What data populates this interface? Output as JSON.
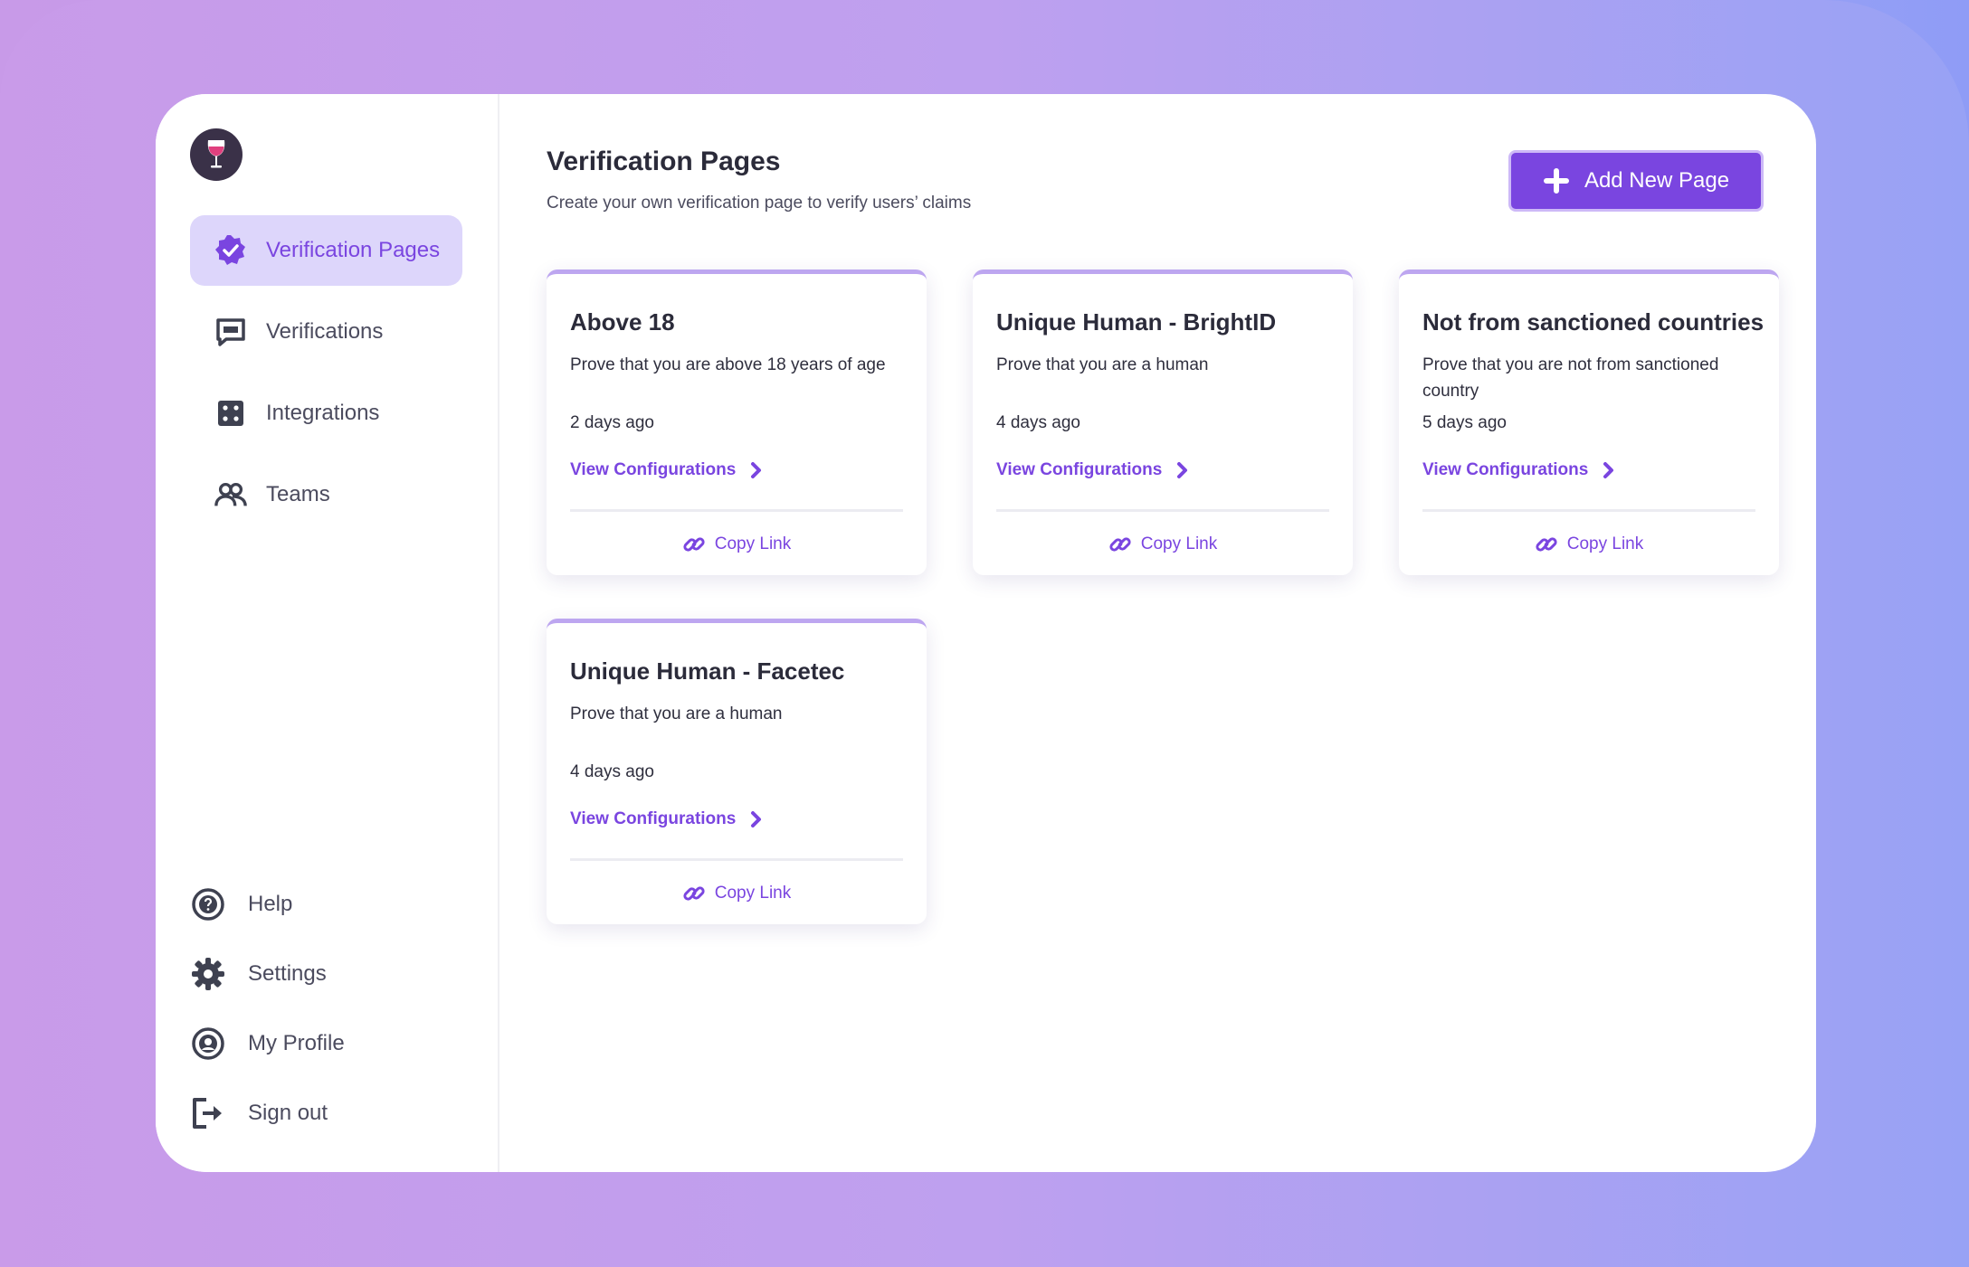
{
  "theme": {
    "accent": "#7a45e0",
    "accent_light": "#ddd6fb",
    "text_dark": "#2b2b3a",
    "text_muted": "#4b4b5e"
  },
  "sidebar": {
    "logo_icon": "wine-glass-icon",
    "nav": [
      {
        "label": "Verification Pages",
        "icon": "badge-check-icon",
        "active": true
      },
      {
        "label": "Verifications",
        "icon": "message-square-icon",
        "active": false
      },
      {
        "label": "Integrations",
        "icon": "dice-grid-icon",
        "active": false
      },
      {
        "label": "Teams",
        "icon": "users-icon",
        "active": false
      }
    ],
    "bottom": [
      {
        "label": "Help",
        "icon": "help-circle-icon"
      },
      {
        "label": "Settings",
        "icon": "gear-icon"
      },
      {
        "label": "My Profile",
        "icon": "user-circle-icon"
      },
      {
        "label": "Sign out",
        "icon": "sign-out-icon"
      }
    ]
  },
  "header": {
    "title": "Verification Pages",
    "subtitle": "Create your own verification page to verify users’ claims",
    "add_button_label": "Add New Page"
  },
  "cards": [
    {
      "title": "Above 18",
      "description": "Prove that you are above 18 years of age",
      "time": "2 days ago",
      "view_label": "View Configurations",
      "copy_label": "Copy Link"
    },
    {
      "title": "Unique Human - BrightID",
      "description": "Prove that you are a human",
      "time": "4 days ago",
      "view_label": "View Configurations",
      "copy_label": "Copy Link"
    },
    {
      "title": "Not from sanctioned countries",
      "description": "Prove that you are not from sanctioned country",
      "time": "5 days ago",
      "view_label": "View Configurations",
      "copy_label": "Copy Link"
    },
    {
      "title": "Unique Human - Facetec",
      "description": "Prove that you are a human",
      "time": "4 days ago",
      "view_label": "View Configurations",
      "copy_label": "Copy Link"
    }
  ]
}
